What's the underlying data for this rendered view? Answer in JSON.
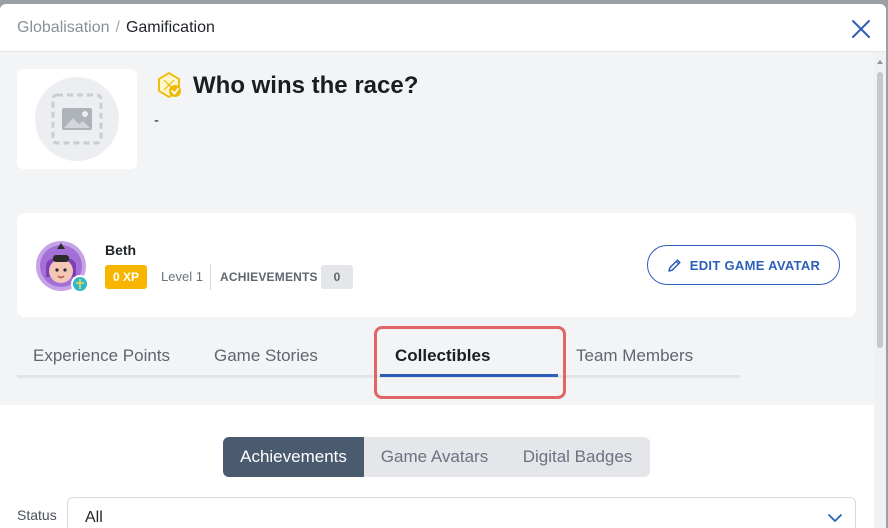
{
  "header": {
    "breadcrumb_parent": "Globalisation",
    "breadcrumb_separator": "/",
    "breadcrumb_current": "Gamification",
    "close_icon": "close-icon"
  },
  "game": {
    "title": "Who wins the race?",
    "description": "-",
    "image_icon": "image-placeholder-icon",
    "title_icon": "verified-game-icon"
  },
  "player": {
    "name": "Beth",
    "xp": "0 XP",
    "level": "Level 1",
    "achievements_label": "ACHIEVEMENTS",
    "achievements_count": "0",
    "edit_button": "EDIT GAME AVATAR"
  },
  "tabs": [
    {
      "label": "Experience Points",
      "active": false
    },
    {
      "label": "Game Stories",
      "active": false
    },
    {
      "label": "Collectibles",
      "active": true
    },
    {
      "label": "Team Members",
      "active": false
    }
  ],
  "collectibles": {
    "segments": [
      {
        "label": "Achievements",
        "active": true
      },
      {
        "label": "Game Avatars",
        "active": false
      },
      {
        "label": "Digital Badges",
        "active": false
      }
    ],
    "status_label": "Status",
    "status_value": "All"
  },
  "colors": {
    "accent": "#2d5fb8",
    "xp_badge": "#f7b500",
    "highlight": "#e06666",
    "segment_active": "#4a5a6f"
  }
}
